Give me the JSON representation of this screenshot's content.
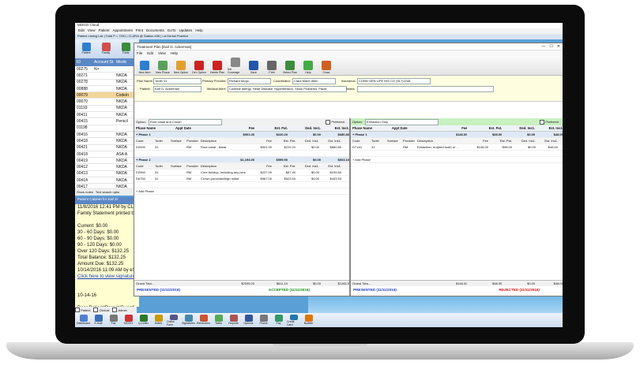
{
  "bg_window": {
    "title": "MOGO Cloud",
    "menu": [
      "Edit",
      "View",
      "Patient",
      "Appointment",
      "Print",
      "Documents",
      "GoTo",
      "Updates",
      "Help"
    ],
    "tabs": "Patient Listing List | Total P = 7091 | CLARA @ Station #36 | LA Dental Practice",
    "toolbar": [
      "Patient",
      "Family",
      "Trans"
    ],
    "grid_headers": [
      "ID",
      "Account St",
      "Medic"
    ],
    "grid_rows": [
      {
        "id": "00275",
        "acct": "N>",
        "medic": ""
      },
      {
        "id": "00271",
        "acct": "",
        "medic": "NKDA"
      },
      {
        "id": "00278",
        "acct": "",
        "medic": "NKDA"
      },
      {
        "id": "00888",
        "acct": "",
        "medic": "NKDA"
      },
      {
        "id": "00079",
        "acct": "",
        "medic": "Codein",
        "selected": true
      },
      {
        "id": "00070",
        "acct": "",
        "medic": "NKDA"
      },
      {
        "id": "01193",
        "acct": "",
        "medic": "NKDA"
      },
      {
        "id": "00411",
        "acct": "",
        "medic": "NKDA"
      },
      {
        "id": "00415",
        "acct": "",
        "medic": "Penicil"
      },
      {
        "id": "01198",
        "acct": "",
        "medic": ""
      },
      {
        "id": "00416",
        "acct": "",
        "medic": "NKDA"
      },
      {
        "id": "00418",
        "acct": "",
        "medic": "NKDA"
      },
      {
        "id": "00421",
        "acct": "",
        "medic": "NKDA"
      },
      {
        "id": "00418",
        "acct": "",
        "medic": "ASA A"
      },
      {
        "id": "00419",
        "acct": "",
        "medic": "NKDA"
      },
      {
        "id": "00412",
        "acct": "",
        "medic": "NKDA"
      },
      {
        "id": "00413",
        "acct": "",
        "medic": "NKDA"
      },
      {
        "id": "00414",
        "acct": "",
        "medic": "NKDA"
      },
      {
        "id": "00417",
        "acct": "",
        "medic": "NKDA"
      }
    ],
    "show_notes": "Show notes",
    "text_search": "Text search optio",
    "cabinet_title": "Patient Cabinet for Earl D.",
    "cabinet_lines": [
      "11/8/2016 12:41 PM by CLAR",
      "Family Statement printed by",
      "",
      "Current: $0.00",
      "30 - 60 Days: $0.00",
      "60 - 90 Days: $0.00",
      "90 - 120 Days: $0.00",
      "Over 120 Days: $132.25",
      "Total Balance: $132.25",
      "Amount Due: $132.25",
      "10/14/2016 11:09 AM by eS",
      "Click here to view signature",
      "",
      "",
      "10-14-16",
      "",
      "Dear Patient/Parent/Guardi",
      "We respect your right to do",
      "We are attempting to provide"
    ],
    "check_items": [
      "Patient",
      "Clinical",
      "Admin"
    ],
    "bottom_buttons": [
      "Dashboard",
      "E-mail",
      "Fax",
      "MOGO",
      "Q-Letter",
      "Notes",
      "Online Form",
      "Signatures",
      "Reminders",
      "Tasks",
      "Reports",
      "Options",
      "Phone",
      "Pay",
      "Credit Card",
      "Bulletin"
    ]
  },
  "tp": {
    "title": "Treatment Plan [Earl D. Ackerman]",
    "controls": [
      "—",
      "☐",
      "✕"
    ],
    "menu": [
      "File",
      "Edit",
      "View",
      "Help"
    ],
    "toolbar": [
      {
        "label": "New Item",
        "color": "#2f7fd0"
      },
      {
        "label": "New Phase",
        "color": "#5aa05a"
      },
      {
        "label": "New Option",
        "color": "#e0a030"
      },
      {
        "label": "Del. Option",
        "color": "#cc2222"
      },
      {
        "label": "Delete Plan",
        "color": "#cc2222"
      },
      {
        "label": "Set Coverage",
        "color": "#888888"
      },
      {
        "label": "Save",
        "color": "#2255aa"
      },
      {
        "label": "Print",
        "color": "#666666"
      },
      {
        "label": "Select Plan",
        "color": "#3c8c3c"
      },
      {
        "label": "Help",
        "color": "#44aa44"
      },
      {
        "label": "Close",
        "color": "#d06020"
      }
    ],
    "form": {
      "plan_name_label": "Plan Name:",
      "plan_name": "Tooth 31",
      "patient_label": "Patient:",
      "patient": "Earl D. Ackerman",
      "primary_provider_label": "Primary Provider:",
      "primary_provider": "Richard Mogo",
      "medical_alert_label": "Medical Alert:",
      "medical_alert": "Codeine allergy, Heart Disease, Hypertension, Sinus Problems, Pacer",
      "coordinator_label": "Coordinator:",
      "coordinator": "Clara Marie Allen",
      "insurance_label": "Insurance:",
      "insurance": "CONN GEN LIFE INS CO (517)2248",
      "notes_label": "Notes:",
      "notes": ""
    },
    "left_option": {
      "option_label": "Option:",
      "option_value": "Root canal and Crown",
      "preferred": "Preferred",
      "headers": [
        "Phase Name",
        "Appt Date",
        "Fee",
        "Est. Pat.",
        "Ded. Ins1.",
        "Est. Ins1."
      ],
      "sub_headers": [
        "Code",
        "Tooth",
        "Surface",
        "Provider",
        "Description",
        "Fee",
        "Est. Pat.",
        "Ded. Ins1.",
        "Est. Ins1."
      ],
      "rows": [
        {
          "type": "phase",
          "cells": [
            "+  Phase 1",
            "",
            "$901.00",
            "$220.20",
            "$0.00",
            "$680.80"
          ]
        },
        {
          "type": "sub",
          "cells": [
            "Code",
            "Tooth",
            "Surface",
            "Provider",
            "Description",
            "Fee",
            "Est. Pat.",
            "Ded. Ins1.",
            "Est. Ins1."
          ]
        },
        {
          "type": "item",
          "cells": [
            "D3330",
            "31",
            "",
            "RM",
            "Root canal - Molar",
            "$901.00",
            "$220.20",
            "$0.00",
            "$680.80"
          ]
        },
        {
          "type": "item",
          "cells": [
            "",
            "",
            "",
            "",
            "",
            "",
            "",
            "",
            ""
          ]
        },
        {
          "type": "phase",
          "cells": [
            "+  Phase 2",
            "",
            "$1,194.00",
            "$599.90",
            "$0.00",
            "$603.10"
          ]
        },
        {
          "type": "sub",
          "cells": [
            "Code",
            "Tooth",
            "Surface",
            "Provider",
            "Description",
            "Fee",
            "Est. Pat.",
            "Ded. Ins1.",
            "Est. Ins1."
          ]
        },
        {
          "type": "item",
          "cells": [
            "D2950",
            "31",
            "",
            "RM",
            "Core buildup, including any pins",
            "$227.00",
            "$67.40",
            "$0.00",
            "$159.60"
          ]
        },
        {
          "type": "item",
          "cells": [
            "D6750",
            "31",
            "",
            "RM",
            "Crown porcelain/high noble",
            "$967.00",
            "$523.50",
            "$0.00",
            "$443.50"
          ]
        },
        {
          "type": "item",
          "cells": [
            "",
            "",
            "",
            "",
            "",
            "",
            "",
            "",
            ""
          ]
        },
        {
          "type": "add",
          "cells": [
            "+ Add Phase",
            "",
            "",
            "",
            "",
            ""
          ]
        }
      ],
      "grand": [
        "Grand Tota...",
        "",
        "$2095.00",
        "$811.10",
        "$0.00",
        "$1283.9"
      ],
      "status_left": "PRESENTED (11/11/2016)",
      "status_right": "ACCEPTED (11/11/2016)"
    },
    "right_option": {
      "option_label": "Option:",
      "option_value": "Extraction Only",
      "preferred": "Preferred",
      "headers": [
        "Phase Name",
        "Appt Date",
        "Fee",
        "Est. Pat.",
        "Ded. Ins1.",
        "Est. Ins1."
      ],
      "rows": [
        {
          "type": "phase",
          "cells": [
            "+  Phase 1",
            "",
            "$146.00",
            "$98.00",
            "$0.00",
            "$48.00"
          ]
        },
        {
          "type": "sub",
          "cells": [
            "Code",
            "Tooth",
            "Surface",
            "Provider",
            "Description",
            "Fee",
            "Est. Pat.",
            "Ded. Ins1.",
            "Est. Ins1."
          ]
        },
        {
          "type": "item",
          "cells": [
            "D7140",
            "31",
            "",
            "RM",
            "Extraction, erupted tooth or ...",
            "$146.00",
            "$98.00",
            "$0.00",
            "$48.00"
          ]
        },
        {
          "type": "item",
          "cells": [
            "",
            "",
            "",
            "",
            "",
            "",
            "",
            "",
            ""
          ]
        },
        {
          "type": "add",
          "cells": [
            "+ Add Phase",
            "",
            "",
            "",
            "",
            ""
          ]
        }
      ],
      "grand": [
        "Grand Tota...",
        "",
        "$146.00",
        "$98.00",
        "$0.00",
        "$48.00"
      ],
      "status_left": "PRESENTED (11/11/2016)",
      "status_right": "REJECTED (11/11/2016)"
    }
  },
  "colors": {
    "accepted": "#1a8a1a",
    "rejected": "#d01010",
    "presented": "#1f3fbf",
    "option_green": "#c8f0c0",
    "phase_header": "#dfe9f5"
  }
}
